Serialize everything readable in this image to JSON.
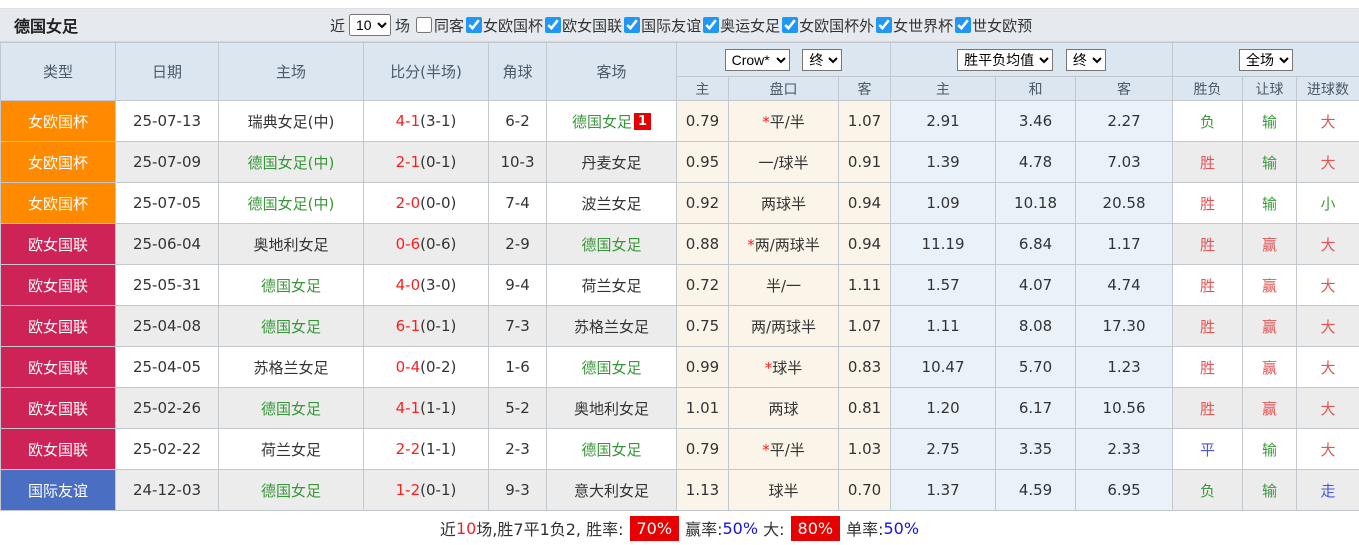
{
  "filter_bar": {
    "title": "德国女足",
    "near_label": "近",
    "near_value": "10",
    "games_label": "场",
    "same_venue_label": "同客",
    "competitions": [
      "女欧国杯",
      "欧女国联",
      "国际友谊",
      "奥运女足",
      "女欧国杯外",
      "女世界杯",
      "世女欧预"
    ]
  },
  "header": {
    "columns": [
      "类型",
      "日期",
      "主场",
      "比分(半场)",
      "角球",
      "客场"
    ],
    "odds_company": "Crow*",
    "odds_period": "终",
    "avg_select": "胜平负均值",
    "avg_period": "终",
    "scope_select": "全场",
    "sub_columns": [
      "主",
      "盘口",
      "客",
      "主",
      "和",
      "客",
      "胜负",
      "让球",
      "进球数"
    ]
  },
  "symbols": {
    "handicap_star": "*"
  },
  "colors": {
    "badge_orange": "#ff8a00",
    "badge_crimson": "#cd2357",
    "badge_blue": "#4a6ec2",
    "team_green": "#389738",
    "score_red": "#fa1e1e",
    "result_red": "#e25555",
    "result_green": "#3c9b3c",
    "result_blue": "#4956d6",
    "footer_badge_red": "#e60000",
    "footer_pct_blue": "#1414dc"
  },
  "rows": [
    {
      "type": "女欧国杯",
      "type_color": "#ff8a00",
      "date": "25-07-13",
      "home": "瑞典女足(中)",
      "home_green": false,
      "score": "4-1",
      "half": "(3-1)",
      "corner": "6-2",
      "away": "德国女足",
      "away_green": true,
      "away_badge": "1",
      "ah_home": "0.79",
      "ah_star": true,
      "ah_line": "平/半",
      "ah_away": "1.07",
      "avg_home": "2.91",
      "avg_draw": "3.46",
      "avg_away": "2.27",
      "result": "负",
      "result_color": "green",
      "handicap_result": "输",
      "handicap_result_color": "green",
      "goals": "大",
      "goals_color": "red"
    },
    {
      "type": "女欧国杯",
      "type_color": "#ff8a00",
      "date": "25-07-09",
      "home": "德国女足(中)",
      "home_green": true,
      "score": "2-1",
      "half": "(0-1)",
      "corner": "10-3",
      "away": "丹麦女足",
      "away_green": false,
      "away_badge": null,
      "ah_home": "0.95",
      "ah_star": false,
      "ah_line": "一/球半",
      "ah_away": "0.91",
      "avg_home": "1.39",
      "avg_draw": "4.78",
      "avg_away": "7.03",
      "result": "胜",
      "result_color": "red",
      "handicap_result": "输",
      "handicap_result_color": "green",
      "goals": "大",
      "goals_color": "red"
    },
    {
      "type": "女欧国杯",
      "type_color": "#ff8a00",
      "date": "25-07-05",
      "home": "德国女足(中)",
      "home_green": true,
      "score": "2-0",
      "half": "(0-0)",
      "corner": "7-4",
      "away": "波兰女足",
      "away_green": false,
      "away_badge": null,
      "ah_home": "0.92",
      "ah_star": false,
      "ah_line": "两球半",
      "ah_away": "0.94",
      "avg_home": "1.09",
      "avg_draw": "10.18",
      "avg_away": "20.58",
      "result": "胜",
      "result_color": "red",
      "handicap_result": "输",
      "handicap_result_color": "green",
      "goals": "小",
      "goals_color": "green"
    },
    {
      "type": "欧女国联",
      "type_color": "#cd2357",
      "date": "25-06-04",
      "home": "奥地利女足",
      "home_green": false,
      "score": "0-6",
      "half": "(0-6)",
      "corner": "2-9",
      "away": "德国女足",
      "away_green": true,
      "away_badge": null,
      "ah_home": "0.88",
      "ah_star": true,
      "ah_line": "两/两球半",
      "ah_away": "0.94",
      "avg_home": "11.19",
      "avg_draw": "6.84",
      "avg_away": "1.17",
      "result": "胜",
      "result_color": "red",
      "handicap_result": "赢",
      "handicap_result_color": "red",
      "goals": "大",
      "goals_color": "red"
    },
    {
      "type": "欧女国联",
      "type_color": "#cd2357",
      "date": "25-05-31",
      "home": "德国女足",
      "home_green": true,
      "score": "4-0",
      "half": "(3-0)",
      "corner": "9-4",
      "away": "荷兰女足",
      "away_green": false,
      "away_badge": null,
      "ah_home": "0.72",
      "ah_star": false,
      "ah_line": "半/一",
      "ah_away": "1.11",
      "avg_home": "1.57",
      "avg_draw": "4.07",
      "avg_away": "4.74",
      "result": "胜",
      "result_color": "red",
      "handicap_result": "赢",
      "handicap_result_color": "red",
      "goals": "大",
      "goals_color": "red"
    },
    {
      "type": "欧女国联",
      "type_color": "#cd2357",
      "date": "25-04-08",
      "home": "德国女足",
      "home_green": true,
      "score": "6-1",
      "half": "(0-1)",
      "corner": "7-3",
      "away": "苏格兰女足",
      "away_green": false,
      "away_badge": null,
      "ah_home": "0.75",
      "ah_star": false,
      "ah_line": "两/两球半",
      "ah_away": "1.07",
      "avg_home": "1.11",
      "avg_draw": "8.08",
      "avg_away": "17.30",
      "result": "胜",
      "result_color": "red",
      "handicap_result": "赢",
      "handicap_result_color": "red",
      "goals": "大",
      "goals_color": "red"
    },
    {
      "type": "欧女国联",
      "type_color": "#cd2357",
      "date": "25-04-05",
      "home": "苏格兰女足",
      "home_green": false,
      "score": "0-4",
      "half": "(0-2)",
      "corner": "1-6",
      "away": "德国女足",
      "away_green": true,
      "away_badge": null,
      "ah_home": "0.99",
      "ah_star": true,
      "ah_line": "球半",
      "ah_away": "0.83",
      "avg_home": "10.47",
      "avg_draw": "5.70",
      "avg_away": "1.23",
      "result": "胜",
      "result_color": "red",
      "handicap_result": "赢",
      "handicap_result_color": "red",
      "goals": "大",
      "goals_color": "red"
    },
    {
      "type": "欧女国联",
      "type_color": "#cd2357",
      "date": "25-02-26",
      "home": "德国女足",
      "home_green": true,
      "score": "4-1",
      "half": "(1-1)",
      "corner": "5-2",
      "away": "奥地利女足",
      "away_green": false,
      "away_badge": null,
      "ah_home": "1.01",
      "ah_star": false,
      "ah_line": "两球",
      "ah_away": "0.81",
      "avg_home": "1.20",
      "avg_draw": "6.17",
      "avg_away": "10.56",
      "result": "胜",
      "result_color": "red",
      "handicap_result": "赢",
      "handicap_result_color": "red",
      "goals": "大",
      "goals_color": "red"
    },
    {
      "type": "欧女国联",
      "type_color": "#cd2357",
      "date": "25-02-22",
      "home": "荷兰女足",
      "home_green": false,
      "score": "2-2",
      "half": "(1-1)",
      "corner": "2-3",
      "away": "德国女足",
      "away_green": true,
      "away_badge": null,
      "ah_home": "0.79",
      "ah_star": true,
      "ah_line": "平/半",
      "ah_away": "1.03",
      "avg_home": "2.75",
      "avg_draw": "3.35",
      "avg_away": "2.33",
      "result": "平",
      "result_color": "blue",
      "handicap_result": "输",
      "handicap_result_color": "green",
      "goals": "大",
      "goals_color": "red"
    },
    {
      "type": "国际友谊",
      "type_color": "#4a6ec2",
      "date": "24-12-03",
      "home": "德国女足",
      "home_green": true,
      "score": "1-2",
      "half": "(0-1)",
      "corner": "9-3",
      "away": "意大利女足",
      "away_green": false,
      "away_badge": null,
      "ah_home": "1.13",
      "ah_star": false,
      "ah_line": "球半",
      "ah_away": "0.70",
      "avg_home": "1.37",
      "avg_draw": "4.59",
      "avg_away": "6.95",
      "result": "负",
      "result_color": "green",
      "handicap_result": "输",
      "handicap_result_color": "green",
      "goals": "走",
      "goals_color": "blue"
    }
  ],
  "footer": {
    "prefix": "近",
    "count": "10",
    "summary": "场,胜7平1负2, 胜率:",
    "win_rate": "70%",
    "win_label": "赢率:",
    "win_pct": "50%",
    "big_label": "大:",
    "big_pct": "80%",
    "single_label": "单率:",
    "single_pct": "50%"
  }
}
